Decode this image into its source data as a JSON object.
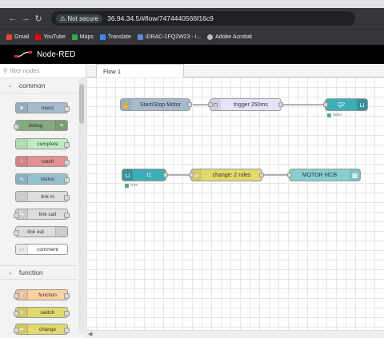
{
  "browser": {
    "not_secure": "Not secure",
    "url": "36.94.34.5/#flow/7474440566f16c9",
    "bookmarks": [
      "Gmail",
      "YouTube",
      "Maps",
      "Translate",
      "iDRAC-1FQ2W23 - i...",
      "Adobe Acrobat"
    ],
    "bookmark_colors": [
      "#ea4335",
      "#ff0000",
      "#34a853",
      "#4285f4",
      "#5f8bd6",
      "#bbbbbb"
    ]
  },
  "app": {
    "title": "Node-RED"
  },
  "palette": {
    "filter_placeholder": "filter nodes",
    "categories": {
      "common": "common",
      "function": "function"
    },
    "nodes": [
      {
        "label": "inject",
        "color": "#a6bbcf",
        "icon": "arrow-right-icon"
      },
      {
        "label": "debug",
        "color": "#87a980",
        "icon": "bug-icon"
      },
      {
        "label": "complete",
        "color": "#c0edc0",
        "icon": "exclamation-icon"
      },
      {
        "label": "catch",
        "color": "#e49191",
        "icon": "exclamation-icon"
      },
      {
        "label": "status",
        "color": "#94c1d0",
        "icon": "pulse-icon"
      },
      {
        "label": "link in",
        "color": "#dddddd",
        "icon": "link-icon"
      },
      {
        "label": "link call",
        "color": "#dddddd",
        "icon": "link-icon"
      },
      {
        "label": "link out",
        "color": "#dddddd",
        "icon": "link-icon"
      },
      {
        "label": "comment",
        "color": "#ffffff",
        "icon": "comment-icon"
      },
      {
        "label": "function",
        "color": "#fdd0a2",
        "icon": "function-icon"
      },
      {
        "label": "switch",
        "color": "#e2d96e",
        "icon": "switch-icon"
      },
      {
        "label": "change",
        "color": "#e2d96e",
        "icon": "shuffle-icon"
      }
    ]
  },
  "workspace": {
    "tab": "Flow 1",
    "nodes": {
      "start_stop": {
        "label": "Start/Stop Motor",
        "color": "#a6bbcf"
      },
      "trigger": {
        "label": "trigger 250ms",
        "color": "#e6e0f8"
      },
      "q2": {
        "label": "Q2",
        "color": "#3fadb5",
        "status": "false"
      },
      "i1": {
        "label": "I1",
        "color": "#3fadb5",
        "status": "true"
      },
      "change": {
        "label": "change: 2 rules",
        "color": "#e2d96e"
      },
      "motor": {
        "label": "MOTOR MCB",
        "color": "#87cfcf"
      }
    }
  }
}
